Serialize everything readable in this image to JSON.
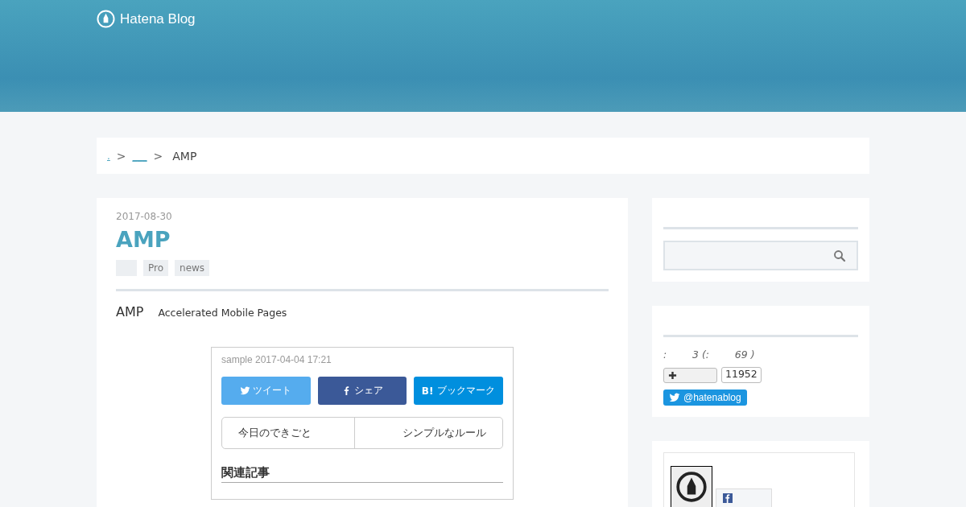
{
  "header": {
    "logo_text": "Hatena Blog"
  },
  "breadcrumb": {
    "items": [
      {
        "label": ".",
        "kind": "link"
      },
      {
        "label": "___",
        "kind": "link"
      },
      {
        "label": "AMP",
        "kind": "current"
      }
    ],
    "separator": ">"
  },
  "article": {
    "date": "2017-08-30",
    "title": "AMP",
    "tags": [
      {
        "kind": "blank"
      },
      {
        "kind": "text",
        "label": "Pro"
      },
      {
        "kind": "text",
        "label": "news"
      }
    ],
    "lead": {
      "term": "AMP",
      "text": "Accelerated Mobile Pages"
    },
    "sample": {
      "meta": "sample 2017-04-04 17:21",
      "share_buttons": [
        {
          "kind": "twitter",
          "label": "ツイート"
        },
        {
          "kind": "facebook",
          "label": "シェア"
        },
        {
          "kind": "hatena",
          "label": "ブックマーク",
          "mark": "B!"
        }
      ],
      "pager": [
        "今日のできごと",
        "シンプルなルール"
      ],
      "related_heading": "関連記事"
    }
  },
  "sidebar": {
    "stats": {
      "text": ":        3 (:        69 )",
      "bookmark_count": "11952",
      "follow_label": "@hatenablog"
    }
  }
}
